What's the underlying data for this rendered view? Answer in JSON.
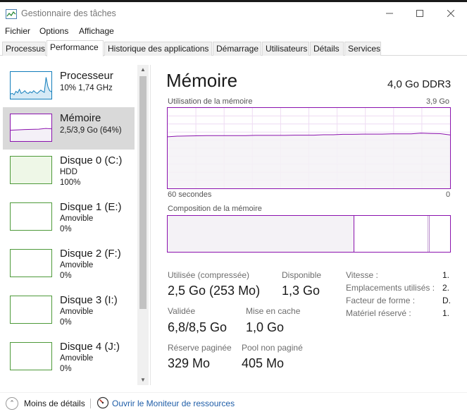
{
  "window": {
    "title": "Gestionnaire des tâches"
  },
  "menu": [
    "Fichier",
    "Options",
    "Affichage"
  ],
  "tabs": [
    {
      "label": "Processus",
      "active": false
    },
    {
      "label": "Performance",
      "active": true
    },
    {
      "label": "Historique des applications",
      "active": false
    },
    {
      "label": "Démarrage",
      "active": false
    },
    {
      "label": "Utilisateurs",
      "active": false
    },
    {
      "label": "Détails",
      "active": false
    },
    {
      "label": "Services",
      "active": false
    }
  ],
  "sidebar": {
    "items": [
      {
        "name": "Processeur",
        "lines": [
          "10%  1,74 GHz"
        ],
        "selected": false,
        "kind": "cpu",
        "graph_color": "#117dbb",
        "utilization": 0.1
      },
      {
        "name": "Mémoire",
        "lines": [
          "2,5/3,9 Go (64%)"
        ],
        "selected": true,
        "kind": "memory",
        "graph_color": "#8b12ae",
        "utilization": 0.64
      },
      {
        "name": "Disque 0 (C:)",
        "lines": [
          "HDD",
          "100%"
        ],
        "selected": false,
        "kind": "disk",
        "graph_color": "#4da60c",
        "utilization": 1.0
      },
      {
        "name": "Disque 1 (E:)",
        "lines": [
          "Amovible",
          "0%"
        ],
        "selected": false,
        "kind": "disk",
        "graph_color": "#4da60c",
        "utilization": 0
      },
      {
        "name": "Disque 2 (F:)",
        "lines": [
          "Amovible",
          "0%"
        ],
        "selected": false,
        "kind": "disk",
        "graph_color": "#4da60c",
        "utilization": 0
      },
      {
        "name": "Disque 3 (I:)",
        "lines": [
          "Amovible",
          "0%"
        ],
        "selected": false,
        "kind": "disk",
        "graph_color": "#4da60c",
        "utilization": 0
      },
      {
        "name": "Disque 4 (J:)",
        "lines": [
          "Amovible",
          "0%"
        ],
        "selected": false,
        "kind": "disk",
        "graph_color": "#4da60c",
        "utilization": 0
      }
    ]
  },
  "main": {
    "title": "Mémoire",
    "spec": "4,0 Go DDR3",
    "usage_chart": {
      "label": "Utilisation de la mémoire",
      "max_label": "3,9 Go",
      "time_left": "60 secondes",
      "time_right": "0",
      "line_color": "#8b12ae",
      "max_gb": 3.9,
      "values_gb": [
        2.5,
        2.53,
        2.54,
        2.55,
        2.56,
        2.56,
        2.56,
        2.56,
        2.56,
        2.57,
        2.57,
        2.57,
        2.57,
        2.58,
        2.58,
        2.58,
        2.6,
        2.6,
        2.62,
        2.62,
        2.63,
        2.63,
        2.63,
        2.64,
        2.64,
        2.64,
        2.68,
        2.66,
        2.65,
        2.59
      ]
    },
    "composition": {
      "label": "Composition de la mémoire",
      "in_use_fraction": 0.66,
      "modified_fraction": 0.26,
      "standby_fraction": 0.07
    },
    "stats": {
      "used_label": "Utilisée (compressée)",
      "used_value": "2,5 Go (253 Mo)",
      "available_label": "Disponible",
      "available_value": "1,3 Go",
      "committed_label": "Validée",
      "committed_value": "6,8/8,5 Go",
      "cached_label": "Mise en cache",
      "cached_value": "1,0 Go",
      "paged_label": "Réserve paginée",
      "paged_value": "329 Mo",
      "nonpaged_label": "Pool non paginé",
      "nonpaged_value": "405 Mo"
    },
    "details": [
      {
        "label": "Vitesse :",
        "value": "1."
      },
      {
        "label": "Emplacements utilisés :",
        "value": "2."
      },
      {
        "label": "Facteur de forme :",
        "value": "D."
      },
      {
        "label": "Matériel réservé :",
        "value": "1."
      }
    ]
  },
  "footer": {
    "less_details": "Moins de détails",
    "resource_monitor": "Ouvrir le Moniteur de ressources"
  }
}
